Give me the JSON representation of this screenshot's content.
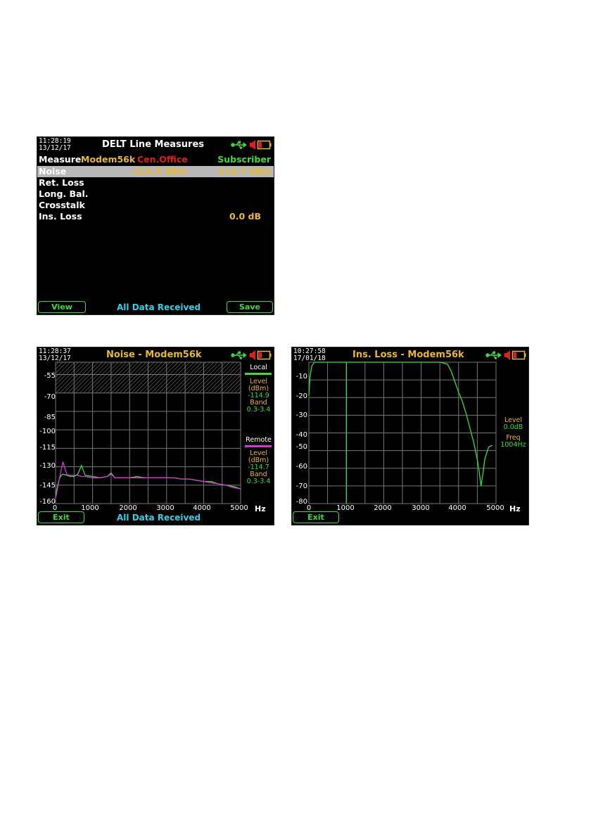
{
  "colors": {
    "green": "#3ddc3d",
    "yellow": "#e8b932",
    "red": "#e51c1c",
    "cyan": "#2ed1e6",
    "magenta": "#cf3bcf",
    "grid": "#777777"
  },
  "icons": [
    "usb-icon",
    "speaker-icon",
    "battery-icon"
  ],
  "screen1": {
    "time": "11:28:19",
    "date": "13/12/17",
    "title": "DELT Line Measures",
    "header": {
      "measure": "Measure",
      "mode": "Modem56k",
      "cen_office": "Cen.Office",
      "subscriber": "Subscriber"
    },
    "rows": [
      {
        "label": "Noise",
        "cen_office": "-114.9 dBm",
        "subscriber": "-114.7 dBm"
      },
      {
        "label": "Ret. Loss",
        "cen_office": "",
        "subscriber": ""
      },
      {
        "label": "Long. Bal.",
        "cen_office": "",
        "subscriber": ""
      },
      {
        "label": "Crosstalk",
        "cen_office": "",
        "subscriber": ""
      },
      {
        "label": "Ins. Loss",
        "cen_office": "",
        "subscriber": "0.0 dB"
      }
    ],
    "left_key": "View",
    "right_key": "Save",
    "status": "All Data Received"
  },
  "screen2": {
    "time": "11:28:37",
    "date": "13/12/17",
    "title": "Noise - Modem56k",
    "left_key": "Exit",
    "status": "All Data Received",
    "local": {
      "label": "Local",
      "level_label": "Level",
      "unit": "(dBm)",
      "level": "-114.9",
      "band_label": "Band",
      "band": "0.3-3.4"
    },
    "remote": {
      "label": "Remote",
      "level_label": "Level",
      "unit": "(dBm)",
      "level": "-114.7",
      "band_label": "Band",
      "band": "0.3-3.4"
    }
  },
  "screen3": {
    "time": "10:27:58",
    "date": "17/01/18",
    "title": "Ins. Loss - Modem56k",
    "left_key": "Exit",
    "level_label": "Level",
    "level": "0.0dB",
    "freq_label": "Freq",
    "freq": "1004Hz"
  },
  "chart_data": [
    {
      "type": "line",
      "title": "Noise - Modem56k",
      "xlabel": "Hz",
      "xlim": [
        0,
        5000
      ],
      "ylim": [
        -160,
        -45
      ],
      "yticks": [
        -55,
        -70,
        -85,
        -100,
        -115,
        -130,
        -145,
        -160
      ],
      "xticks": [
        0,
        1000,
        2000,
        3000,
        4000,
        5000
      ],
      "mask_band": [
        -45,
        -70
      ],
      "series": [
        {
          "name": "Local",
          "x": [
            0,
            50,
            100,
            150,
            200,
            300,
            400,
            500,
            600,
            700,
            750,
            800,
            1000,
            1200,
            1400,
            1500,
            1600,
            1800,
            2000,
            2200,
            2400,
            2600,
            2800,
            3000,
            3200,
            3400,
            3600,
            3800,
            4000,
            4200,
            4400,
            4600,
            4800,
            5000
          ],
          "y": [
            -153,
            -146,
            -140,
            -137,
            -136,
            -137,
            -138,
            -138,
            -136,
            -129,
            -133,
            -137,
            -138,
            -139,
            -138,
            -135,
            -139,
            -139,
            -139,
            -138,
            -139,
            -139,
            -139,
            -139,
            -139,
            -140,
            -140,
            -141,
            -142,
            -142,
            -144,
            -145,
            -146,
            -148
          ]
        },
        {
          "name": "Remote",
          "x": [
            0,
            50,
            100,
            150,
            200,
            250,
            300,
            350,
            400,
            500,
            600,
            700,
            800,
            1000,
            1200,
            1400,
            1500,
            1600,
            1800,
            2000,
            2200,
            2400,
            2600,
            2800,
            3000,
            3200,
            3400,
            3600,
            3800,
            4000,
            4200,
            4400,
            4600,
            4800,
            5000
          ],
          "y": [
            -156,
            -148,
            -140,
            -133,
            -126,
            -131,
            -136,
            -137,
            -137,
            -137,
            -137,
            -138,
            -138,
            -139,
            -139,
            -138,
            -136,
            -139,
            -139,
            -139,
            -139,
            -139,
            -139,
            -139,
            -139,
            -139,
            -140,
            -140,
            -141,
            -142,
            -143,
            -144,
            -145,
            -147,
            -148
          ]
        }
      ]
    },
    {
      "type": "line",
      "title": "Ins. Loss - Modem56k",
      "xlabel": "Hz",
      "xlim": [
        0,
        5000
      ],
      "ylim": [
        -80,
        0
      ],
      "yticks": [
        -10,
        -20,
        -30,
        -40,
        -50,
        -60,
        -70,
        -80
      ],
      "xticks": [
        0,
        1000,
        2000,
        3000,
        4000,
        5000
      ],
      "marker_freq": 1004,
      "series": [
        {
          "name": "Ins. Loss",
          "x": [
            0,
            30,
            80,
            150,
            300,
            1000,
            2000,
            3000,
            3500,
            3700,
            3800,
            3900,
            4000,
            4100,
            4200,
            4300,
            4400,
            4500,
            4550,
            4600,
            4650,
            4700,
            4800,
            4900
          ],
          "y": [
            -19,
            -8,
            -2,
            0,
            0,
            0,
            0,
            0,
            0,
            -1,
            -5,
            -11,
            -17,
            -22,
            -29,
            -37,
            -45,
            -55,
            -62,
            -70,
            -63,
            -55,
            -48,
            -47
          ]
        }
      ]
    }
  ]
}
